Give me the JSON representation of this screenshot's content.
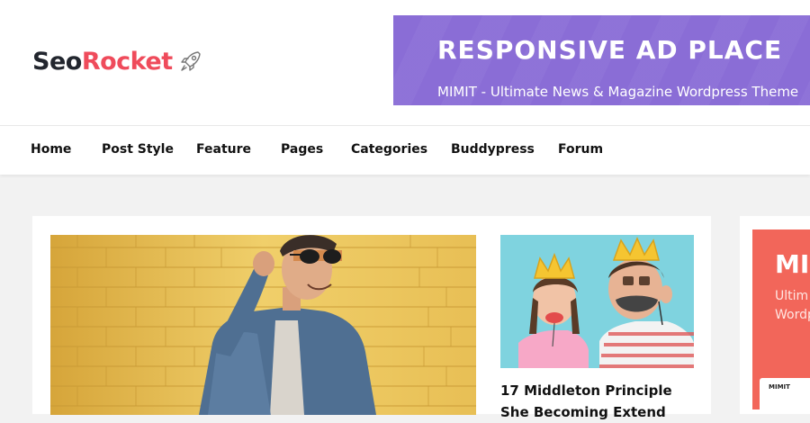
{
  "brand": {
    "logo_part1": "Seo",
    "logo_part2": "Rocket",
    "logo_icon": "rocket-icon",
    "colors": {
      "dark": "#22262e",
      "accent": "#ef4b5b"
    }
  },
  "ad": {
    "title": "RESPONSIVE AD PLACE",
    "subtitle": "MIMIT - Ultimate News & Magazine Wordpress Theme",
    "background": "#8a6dd6"
  },
  "nav": {
    "items": [
      "Home",
      "Post Style",
      "Feature",
      "Pages",
      "Categories",
      "Buddypress",
      "Forum"
    ]
  },
  "featured": {
    "hero_image": "man-denim-jacket-photo",
    "thumb_image": "father-daughter-crowns-photo",
    "post_title": "17 Middleton Principle She Becoming Extend"
  },
  "promo": {
    "title": "MI",
    "line1": "Ultim",
    "line2": "Wordp",
    "shot_label": "MIMIT",
    "background": "#f2665a"
  }
}
